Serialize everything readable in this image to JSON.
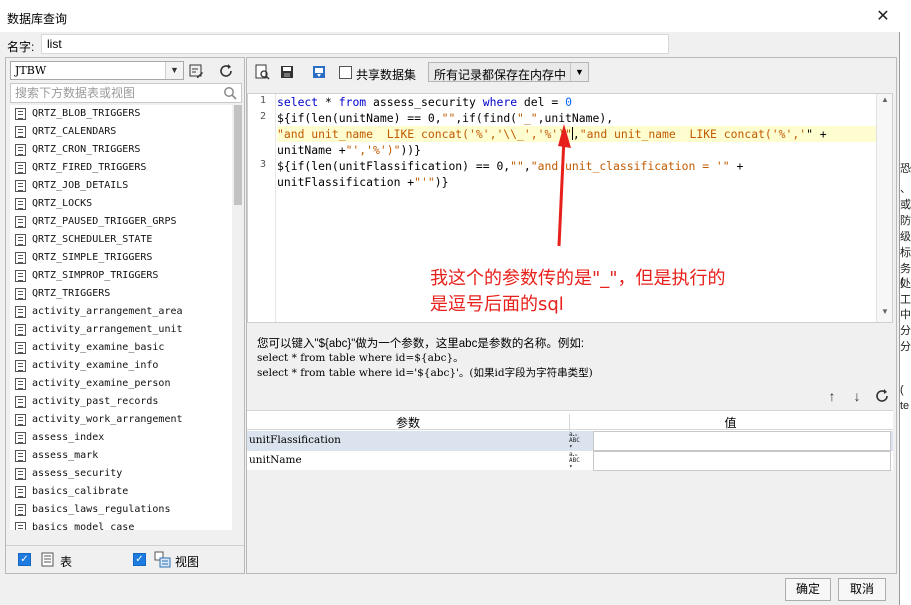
{
  "window": {
    "title": "数据库查询",
    "close_icon": "close-icon"
  },
  "name_field": {
    "label": "名字:",
    "value": "list"
  },
  "left_panel": {
    "datasource": "JTBW",
    "search_placeholder": "搜索下方数据表或视图",
    "tables": [
      "QRTZ_BLOB_TRIGGERS",
      "QRTZ_CALENDARS",
      "QRTZ_CRON_TRIGGERS",
      "QRTZ_FIRED_TRIGGERS",
      "QRTZ_JOB_DETAILS",
      "QRTZ_LOCKS",
      "QRTZ_PAUSED_TRIGGER_GRPS",
      "QRTZ_SCHEDULER_STATE",
      "QRTZ_SIMPLE_TRIGGERS",
      "QRTZ_SIMPROP_TRIGGERS",
      "QRTZ_TRIGGERS",
      "activity_arrangement_area",
      "activity_arrangement_unit",
      "activity_examine_basic",
      "activity_examine_info",
      "activity_examine_person",
      "activity_past_records",
      "activity_work_arrangement",
      "assess_index",
      "assess_mark",
      "assess_security",
      "basics_calibrate",
      "basics_laws_regulations",
      "basics_model_case"
    ],
    "footer": {
      "tables_label": "表",
      "views_label": "视图",
      "tables_checked": true,
      "views_checked": true
    }
  },
  "toolbar": {
    "share_label": "共享数据集",
    "memory_option": "所有记录都保存在内存中"
  },
  "editor": {
    "line_numbers": [
      "1",
      "2",
      "3"
    ],
    "line1": {
      "kw1": "select",
      "t1": " * ",
      "kw2": "from",
      "t2": " assess_security ",
      "kw3": "where",
      "t3": " del = ",
      "num": "0"
    },
    "line2a": {
      "t1": "${if(len(unitName) == 0,",
      "s1": "\"\"",
      "t2": ",if(find(",
      "s2": "\"_\"",
      "t3": ",unitName),"
    },
    "line2b": {
      "s1": "\"and unit_name  LIKE concat('%','\\\\_','%')\"",
      "t1": ",",
      "s2": "\"and unit_name  LIKE concat('%','",
      "t2": "\" +"
    },
    "line2c": {
      "t1": "unitName +",
      "s1": "\"','%')\"",
      "t2": "))}"
    },
    "line3a": {
      "t1": "${if(len(unitFlassification) == 0,",
      "s1": "\"\"",
      "t2": ",",
      "s2": "\"and unit_classification = '\"",
      "t3": " +"
    },
    "line3b": {
      "t1": "unitFlassification +",
      "s1": "\"'\"",
      "t2": ")}"
    }
  },
  "annotation": {
    "line1": "我这个的参数传的是\"_\"，但是执行的",
    "line2": "是逗号后面的sql",
    "color": "#e8201b"
  },
  "help": {
    "line1": "您可以键入\"${abc}\"做为一个参数，这里abc是参数的名称。例如:",
    "line2": "select * from table where id=${abc}。",
    "line3": "select * from table where id='${abc}'。(如果id字段为字符串类型)"
  },
  "param_table": {
    "header_param": "参数",
    "header_value": "值",
    "rows": [
      {
        "name": "unitFlassification",
        "value": ""
      },
      {
        "name": "unitName",
        "value": ""
      }
    ]
  },
  "buttons": {
    "ok": "确定",
    "cancel": "取消"
  },
  "bg_fragment": [
    "恐",
    "、",
    "或",
    "防",
    "级",
    "标",
    "务(",
    "处",
    "工",
    "中",
    "分",
    "分",
    "(",
    "te"
  ]
}
